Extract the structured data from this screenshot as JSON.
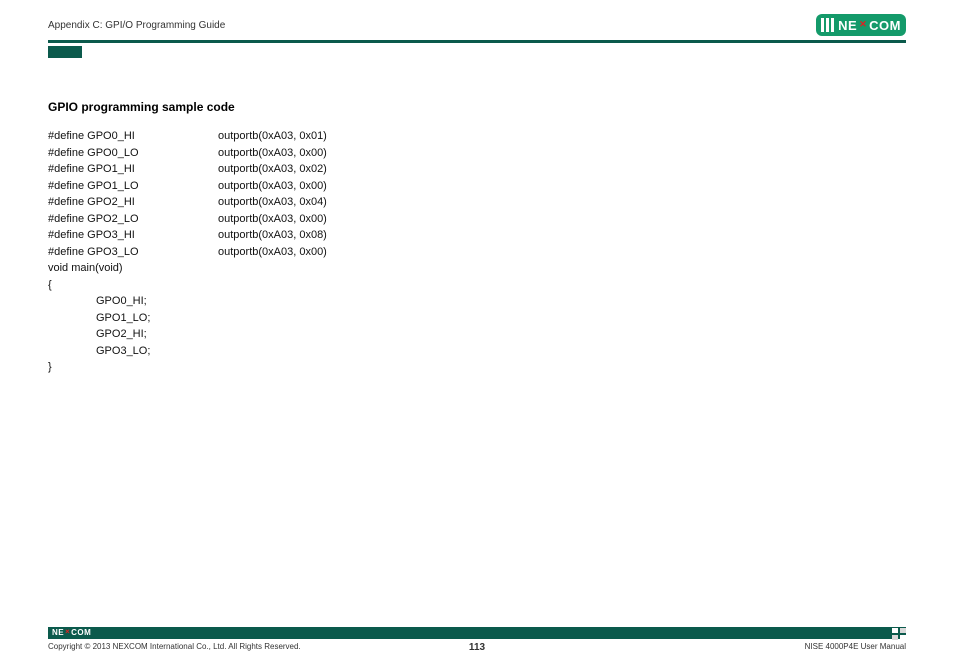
{
  "header": {
    "title": "Appendix C: GPI/O Programming Guide",
    "logo_text_1": "NE",
    "logo_text_2": "COM"
  },
  "section": {
    "title": "GPIO programming sample code"
  },
  "code": {
    "defines": [
      {
        "left": "#define GPO0_HI",
        "right": "outportb(0xA03, 0x01)"
      },
      {
        "left": "#define GPO0_LO",
        "right": "outportb(0xA03, 0x00)"
      },
      {
        "left": "#define GPO1_HI",
        "right": "outportb(0xA03, 0x02)"
      },
      {
        "left": "#define GPO1_LO",
        "right": "outportb(0xA03, 0x00)"
      },
      {
        "left": "#define GPO2_HI",
        "right": "outportb(0xA03, 0x04)"
      },
      {
        "left": "#define GPO2_LO",
        "right": "outportb(0xA03, 0x00)"
      },
      {
        "left": "#define GPO3_HI",
        "right": "outportb(0xA03, 0x08)"
      },
      {
        "left": "#define GPO3_LO",
        "right": "outportb(0xA03, 0x00)"
      }
    ],
    "main_sig": "void main(void)",
    "open_brace": "{",
    "body": [
      "GPO0_HI;",
      "GPO1_LO;",
      "GPO2_HI;",
      "GPO3_LO;"
    ],
    "close_brace": "}"
  },
  "footer": {
    "copyright": "Copyright © 2013 NEXCOM International Co., Ltd. All Rights Reserved.",
    "page": "113",
    "manual": "NISE 4000P4E User Manual",
    "logo_text_1": "NE",
    "logo_text_2": "COM"
  }
}
